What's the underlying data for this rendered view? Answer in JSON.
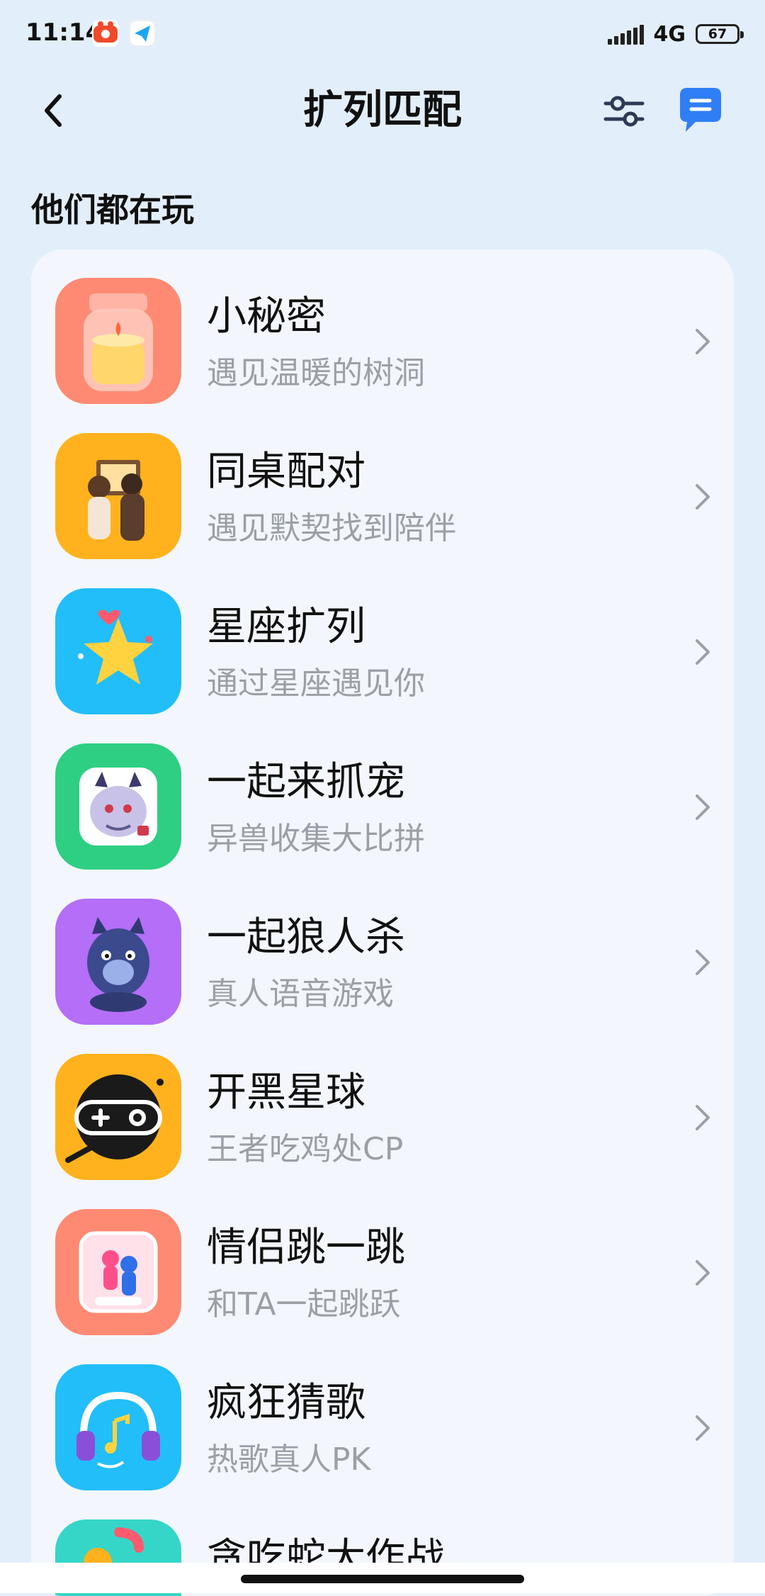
{
  "status_bar": {
    "time": "11:14",
    "network": "4G",
    "battery": "67",
    "icons": [
      "video-app-icon",
      "send-app-icon",
      "signal-icon",
      "battery-icon"
    ]
  },
  "header": {
    "title": "扩列匹配",
    "icons": [
      "back-arrow-icon",
      "filter-sliders-icon",
      "message-bubble-icon"
    ]
  },
  "section": {
    "title": "他们都在玩"
  },
  "colors": {
    "page_background": "#e3eefb",
    "card_background": "#f3f7fd",
    "accent": "#2f7ef6",
    "subtitle": "#9aa0a6"
  },
  "games": [
    {
      "title": "小秘密",
      "subtitle": "遇见温暖的树洞",
      "icon": "candle-jar-icon",
      "color": "#ff8a73"
    },
    {
      "title": "同桌配对",
      "subtitle": "遇见默契找到陪伴",
      "icon": "couple-desk-icon",
      "color": "#ffb21d"
    },
    {
      "title": "星座扩列",
      "subtitle": "通过星座遇见你",
      "icon": "star-icon",
      "color": "#22bef9"
    },
    {
      "title": "一起来抓宠",
      "subtitle": "异兽收集大比拼",
      "icon": "beast-pet-icon",
      "color": "#2ecf83"
    },
    {
      "title": "一起狼人杀",
      "subtitle": "真人语音游戏",
      "icon": "werewolf-icon",
      "color": "#b46ef7"
    },
    {
      "title": "开黑星球",
      "subtitle": "王者吃鸡处CP",
      "icon": "gamepad-planet-icon",
      "color": "#ffb21d"
    },
    {
      "title": "情侣跳一跳",
      "subtitle": "和TA一起跳跃",
      "icon": "jump-couple-icon",
      "color": "#ff8a73"
    },
    {
      "title": "疯狂猜歌",
      "subtitle": "热歌真人PK",
      "icon": "headphones-music-icon",
      "color": "#22bef9"
    },
    {
      "title": "贪吃蛇大作战",
      "subtitle": "",
      "icon": "snake-game-icon",
      "color": "#35d6c8"
    }
  ]
}
